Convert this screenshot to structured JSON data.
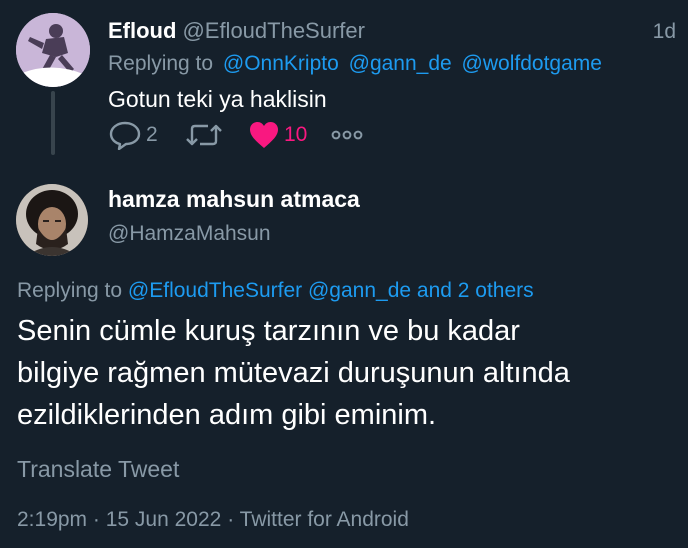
{
  "tweet_parent": {
    "name": "Efloud",
    "handle": "@EfloudTheSurfer",
    "time": "1d",
    "replying_prefix": "Replying to",
    "replying_mentions": [
      "@OnnKripto",
      "@gann_de",
      "@wolfdotgame"
    ],
    "text": "Gotun teki ya haklisin",
    "reply_count": "2",
    "like_count": "10",
    "retweet_count": "",
    "icons": {
      "reply": "reply-icon",
      "retweet": "retweet-icon",
      "like": "heart-icon",
      "more": "more-icon"
    }
  },
  "tweet_main": {
    "name": "hamza mahsun atmaca",
    "handle": "@HamzaMahsun",
    "replying_prefix": "Replying to",
    "replying_mentions": [
      "@EfloudTheSurfer",
      "@gann_de"
    ],
    "replying_suffix": "and 2 others",
    "text_lines": [
      "Senin cümle kuruş tarzının ve bu kadar",
      "bilgiye rağmen mütevazi duruşunun altında",
      "ezildiklerinden adım gibi eminim."
    ],
    "translate_label": "Translate Tweet",
    "time": "2:19pm",
    "date": "15 Jun 2022",
    "source": "Twitter for Android",
    "separator": "·"
  },
  "colors": {
    "background": "#15202b",
    "muted": "#8899a6",
    "link": "#1d9bf0",
    "like": "#f91880",
    "divider": "#38444d"
  }
}
